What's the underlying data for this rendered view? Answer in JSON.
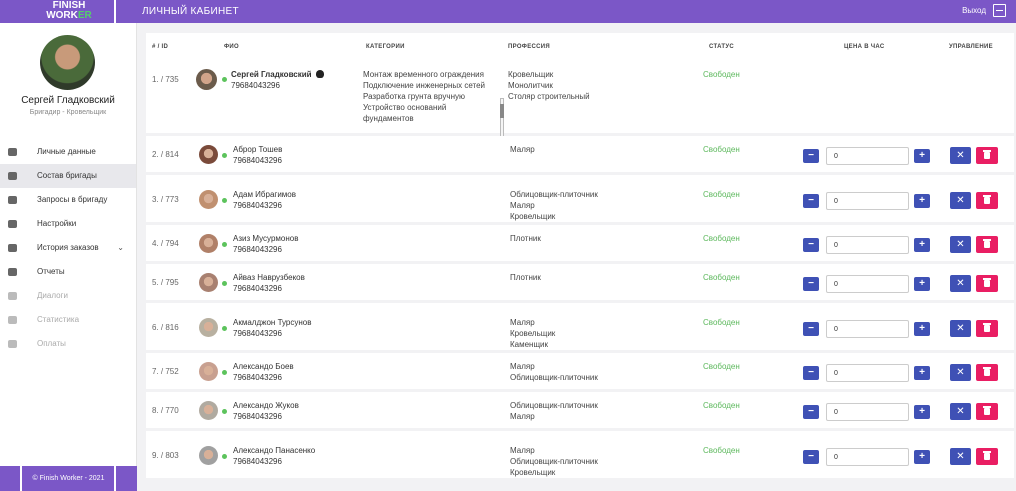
{
  "header": {
    "logo_line1": "FINISH",
    "logo_line2a": "WORK",
    "logo_line2b": "ER",
    "title": "ЛИЧНЫЙ КАБИНЕТ",
    "logout_label": "Выход"
  },
  "profile": {
    "name": "Сергей Гладковский",
    "role": "Бригадир - Кровельщик"
  },
  "menu": [
    {
      "label": "Личные данные",
      "icon": "person-icon",
      "active": false,
      "disabled": false
    },
    {
      "label": "Состав бригады",
      "icon": "group-icon",
      "active": true,
      "disabled": false
    },
    {
      "label": "Запросы в бригаду",
      "icon": "person-add-icon",
      "active": false,
      "disabled": false
    },
    {
      "label": "Настройки",
      "icon": "gear-icon",
      "active": false,
      "disabled": false
    },
    {
      "label": "История заказов",
      "icon": "briefcase-icon",
      "active": false,
      "disabled": false
    },
    {
      "label": "Отчеты",
      "icon": "clipboard-icon",
      "active": false,
      "disabled": false
    },
    {
      "label": "Диалоги",
      "icon": "chat-icon",
      "active": false,
      "disabled": true
    },
    {
      "label": "Статистика",
      "icon": "chart-icon",
      "active": false,
      "disabled": true
    },
    {
      "label": "Оплаты",
      "icon": "card-icon",
      "active": false,
      "disabled": true
    }
  ],
  "footer": "© Finish Worker - 2021",
  "table": {
    "headers": {
      "id": "# / ID",
      "name": "ФИО",
      "categories": "КАТЕГОРИИ",
      "profession": "ПРОФЕССИЯ",
      "status": "СТАТУС",
      "price": "ЦЕНА В ЧАС",
      "manage": "УПРАВЛЕНИЕ"
    },
    "leader": {
      "id": "1. / 735",
      "name": "Сергей Гладковский",
      "phone": "79684043296",
      "categories": [
        "Монтаж временного ограждения",
        "Подключение инженерных сетей",
        "Разработка грунта вручную",
        "Устройство оснований",
        "фундаментов"
      ],
      "professions": [
        "Кровельщик",
        "Монолитчик",
        "Столяр строительный"
      ],
      "status": "Свободен"
    },
    "rows": [
      {
        "id": "2. / 814",
        "name": "Аброр Тошев",
        "phone": "79684043296",
        "professions": [
          "Маляр"
        ],
        "status": "Свободен",
        "price": "0"
      },
      {
        "id": "3. / 773",
        "name": "Адам Ибрагимов",
        "phone": "79684043296",
        "professions": [
          "Облицовщик-плиточник",
          "Маляр",
          "Кровельщик"
        ],
        "status": "Свободен",
        "price": "0"
      },
      {
        "id": "4. / 794",
        "name": "Азиз Мусурмонов",
        "phone": "79684043296",
        "professions": [
          "Плотник"
        ],
        "status": "Свободен",
        "price": "0"
      },
      {
        "id": "5. / 795",
        "name": "Айваз Наврузбеков",
        "phone": "79684043296",
        "professions": [
          "Плотник"
        ],
        "status": "Свободен",
        "price": "0"
      },
      {
        "id": "6. / 816",
        "name": "Акмалджон Турсунов",
        "phone": "79684043296",
        "professions": [
          "Маляр",
          "Кровельщик",
          "Каменщик"
        ],
        "status": "Свободен",
        "price": "0"
      },
      {
        "id": "7. / 752",
        "name": "Александо Боев",
        "phone": "79684043296",
        "professions": [
          "Маляр",
          "Облицовщик-плиточник"
        ],
        "status": "Свободен",
        "price": "0"
      },
      {
        "id": "8. / 770",
        "name": "Александо Жуков",
        "phone": "79684043296",
        "professions": [
          "Облицовщик-плиточник",
          "Маляр"
        ],
        "status": "Свободен",
        "price": "0"
      },
      {
        "id": "9. / 803",
        "name": "Александо Панасенко",
        "phone": "79684043296",
        "professions": [
          "Маляр",
          "Облицовщик-плиточник",
          "Кровельщик"
        ],
        "status": "Свободен",
        "price": "0"
      }
    ],
    "btn_minus": "−",
    "btn_plus": "+",
    "btn_remove": "✕"
  },
  "colors": {
    "brand": "#7b57c7",
    "status_free": "#5cb85c",
    "primary_button": "#3f51b5",
    "danger_button": "#e91e63",
    "online_dot": "#5cc35c"
  }
}
